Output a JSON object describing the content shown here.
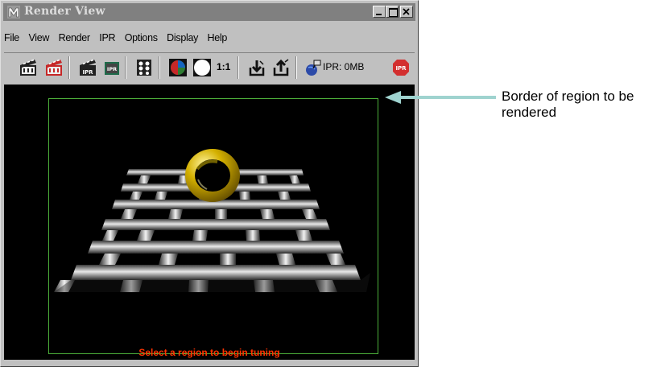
{
  "window": {
    "title": "Render View",
    "controls": {
      "minimize": "minimize-icon",
      "maximize": "maximize-icon",
      "close": "close-icon"
    }
  },
  "menu": [
    "File",
    "View",
    "Render",
    "IPR",
    "Options",
    "Display",
    "Help"
  ],
  "toolbar": {
    "ratio_label": "1:1",
    "ipr_memory": "IPR: 0MB",
    "icons": [
      "redo-render-icon",
      "render-region-icon",
      "ipr-render-icon",
      "ipr-refresh-icon",
      "snapshot-icon",
      "rgb-channels-icon",
      "alpha-channel-icon",
      "real-size-icon",
      "keep-image-icon",
      "remove-image-icon",
      "ipr-memory-icon",
      "ipr-stop-icon"
    ]
  },
  "viewport": {
    "status": "Select a region to begin tuning"
  },
  "annotation": {
    "text": "Border of region to be rendered",
    "arrow_color": "#9fd3cf"
  }
}
